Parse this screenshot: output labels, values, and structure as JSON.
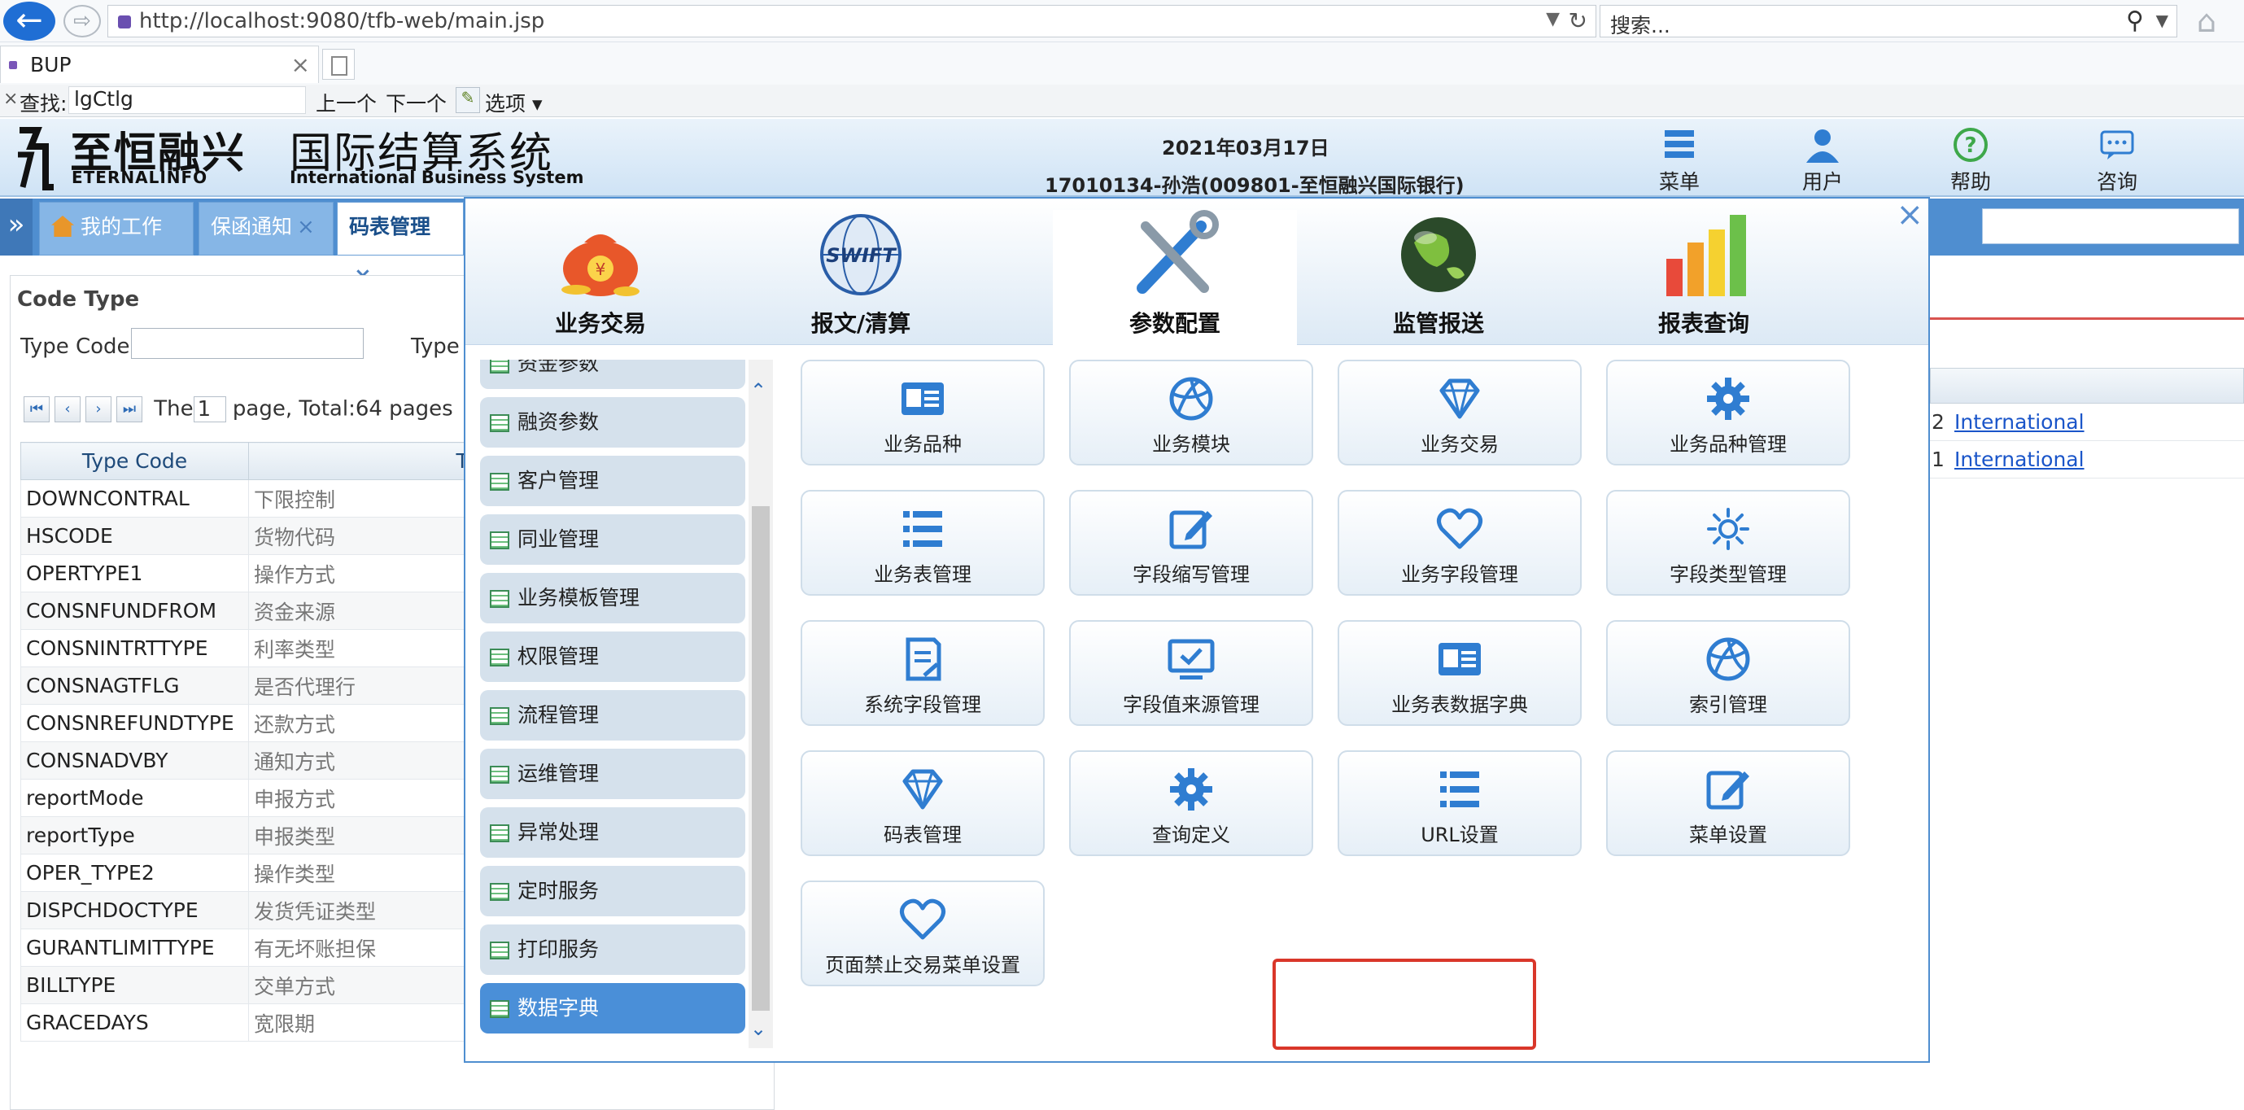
{
  "browser": {
    "url": "http://localhost:9080/tfb-web/main.jsp",
    "search_placeholder": "搜索...",
    "tab_title": "BUP",
    "find_label": "查找:",
    "find_value": "lgCtlg",
    "find_prev": "上一个",
    "find_next": "下一个",
    "find_options": "选项"
  },
  "header": {
    "logo_cn": "至恒融兴",
    "logo_en": "ETERNALINFO",
    "system_cn": "国际结算系统",
    "system_en": "International Business System",
    "date": "2021年03月17日",
    "user": "17010134-孙浩(009801-至恒融兴国际银行)",
    "buttons": [
      {
        "label": "菜单",
        "icon": "menu-list-icon"
      },
      {
        "label": "用户",
        "icon": "user-icon"
      },
      {
        "label": "帮助",
        "icon": "help-icon"
      },
      {
        "label": "咨询",
        "icon": "chat-icon"
      }
    ]
  },
  "app_tabs": [
    {
      "label": "我的工作台",
      "icon": "home-icon"
    },
    {
      "label": "保函通知"
    },
    {
      "label": "码表管理"
    }
  ],
  "code_type": {
    "title": "Code Type",
    "type_code_label": "Type Code",
    "type_label": "Type",
    "pager_prefix": "The",
    "page": "1",
    "pager_suffix": "page, Total:64 pages",
    "columns": [
      "Type Code",
      "Type Name"
    ],
    "rows": [
      [
        "DOWNCONTRAL",
        "下限控制"
      ],
      [
        "HSCODE",
        "货物代码"
      ],
      [
        "OPERTYPE1",
        "操作方式"
      ],
      [
        "CONSNFUNDFROM",
        "资金来源"
      ],
      [
        "CONSNINTRTTYPE",
        "利率类型"
      ],
      [
        "CONSNAGTFLG",
        "是否代理行"
      ],
      [
        "CONSNREFUNDTYPE",
        "还款方式"
      ],
      [
        "CONSNADVBY",
        "通知方式"
      ],
      [
        "reportMode",
        "申报方式"
      ],
      [
        "reportType",
        "申报类型"
      ],
      [
        "OPER_TYPE2",
        "操作类型"
      ],
      [
        "DISPCHDOCTYPE",
        "发货凭证类型"
      ],
      [
        "GURANTLIMITTYPE",
        "有无坏账担保"
      ],
      [
        "BILLTYPE",
        "交单方式"
      ],
      [
        "GRACEDAYS",
        "宽限期"
      ]
    ],
    "right_rows": [
      {
        "num": "2",
        "text": "International"
      },
      {
        "num": "1",
        "text": "International"
      }
    ]
  },
  "menu": {
    "categories": [
      {
        "label": "业务交易",
        "icon": "money-bag-icon"
      },
      {
        "label": "报文/清算",
        "icon": "swift-globe-icon"
      },
      {
        "label": "参数配置",
        "icon": "tools-icon"
      },
      {
        "label": "监管报送",
        "icon": "earth-icon"
      },
      {
        "label": "报表查询",
        "icon": "bar-chart-icon"
      }
    ],
    "side_items": [
      "资金参数",
      "融资参数",
      "客户管理",
      "同业管理",
      "业务模板管理",
      "权限管理",
      "流程管理",
      "运维管理",
      "异常处理",
      "定时服务",
      "打印服务",
      "数据字典"
    ],
    "tiles": [
      {
        "label": "业务品种",
        "icon": "id-card-icon"
      },
      {
        "label": "业务模块",
        "icon": "basketball-icon"
      },
      {
        "label": "业务交易",
        "icon": "diamond-icon"
      },
      {
        "label": "业务品种管理",
        "icon": "gear-icon"
      },
      {
        "label": "业务表管理",
        "icon": "list-icon"
      },
      {
        "label": "字段缩写管理",
        "icon": "edit-icon"
      },
      {
        "label": "业务字段管理",
        "icon": "heart-icon"
      },
      {
        "label": "字段类型管理",
        "icon": "sun-icon"
      },
      {
        "label": "系统字段管理",
        "icon": "document-icon"
      },
      {
        "label": "字段值来源管理",
        "icon": "monitor-check-icon"
      },
      {
        "label": "业务表数据字典",
        "icon": "id-card-icon"
      },
      {
        "label": "索引管理",
        "icon": "basketball-icon"
      },
      {
        "label": "码表管理",
        "icon": "diamond-icon"
      },
      {
        "label": "查询定义",
        "icon": "gear-icon"
      },
      {
        "label": "URL设置",
        "icon": "list-icon"
      },
      {
        "label": "菜单设置",
        "icon": "edit-icon"
      },
      {
        "label": "页面禁止交易菜单设置",
        "icon": "heart-icon"
      }
    ]
  },
  "colors": {
    "accent": "#4f8ed0",
    "highlight": "#d9372a",
    "icon": "#2f7dd1"
  }
}
